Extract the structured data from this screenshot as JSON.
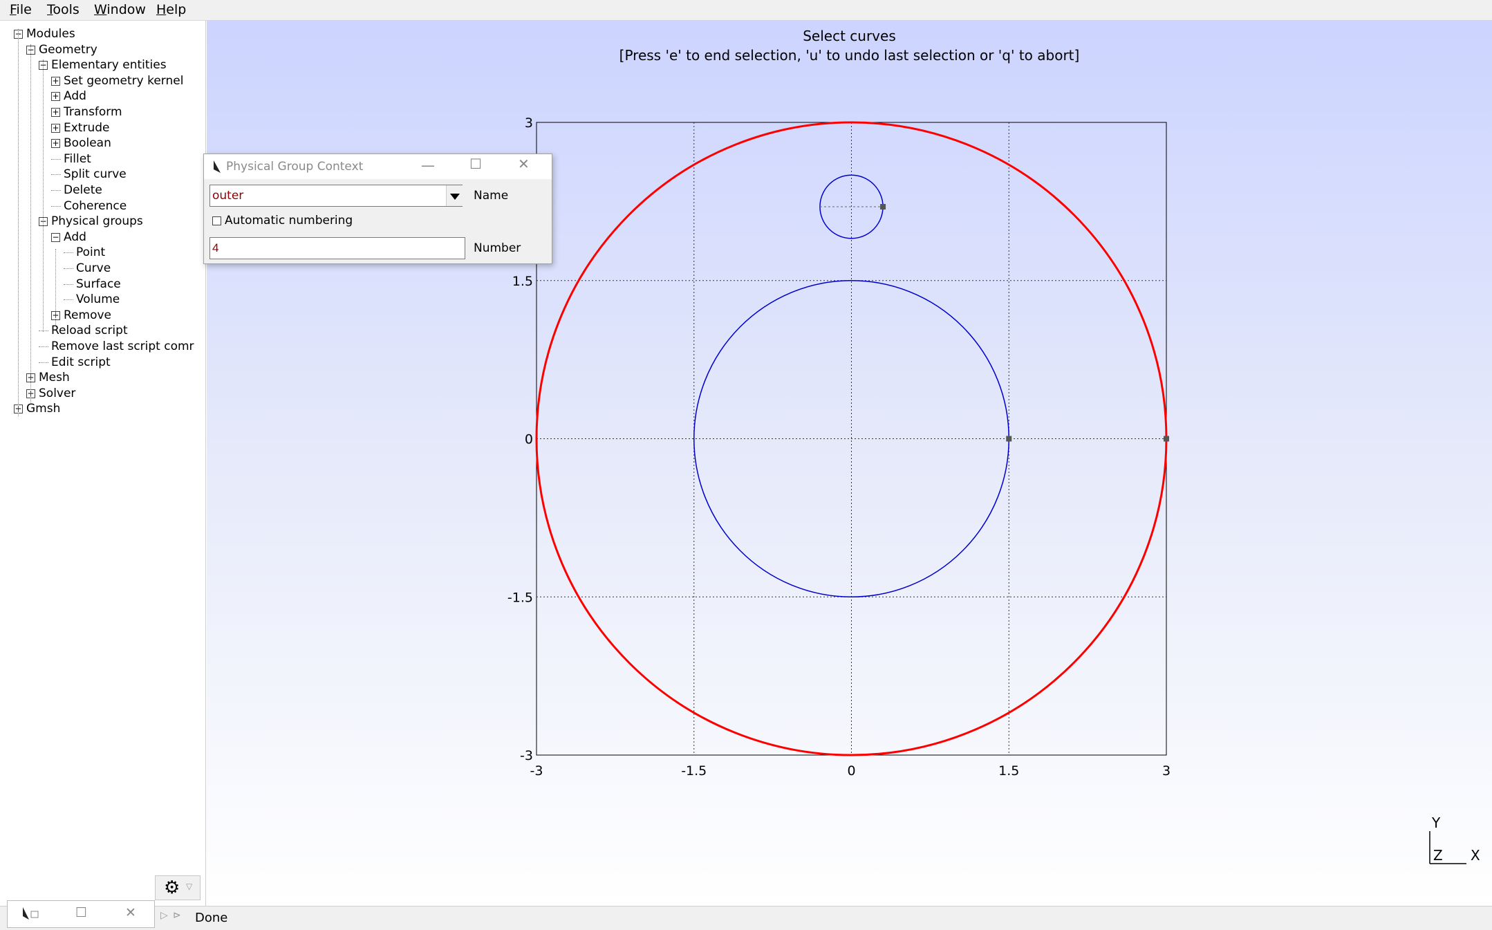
{
  "menu": [
    "File",
    "Tools",
    "Window",
    "Help"
  ],
  "tree": [
    {
      "label": "Modules",
      "box": "minus"
    },
    {
      "label": "Geometry",
      "box": "minus"
    },
    {
      "label": "Elementary entities",
      "box": "minus"
    },
    {
      "label": "Set geometry kernel",
      "box": "plus"
    },
    {
      "label": "Add",
      "box": "plus"
    },
    {
      "label": "Transform",
      "box": "plus"
    },
    {
      "label": "Extrude",
      "box": "plus"
    },
    {
      "label": "Boolean",
      "box": "plus"
    },
    {
      "label": "Fillet",
      "box": "none"
    },
    {
      "label": "Split curve",
      "box": "none"
    },
    {
      "label": "Delete",
      "box": "none"
    },
    {
      "label": "Coherence",
      "box": "none"
    },
    {
      "label": "Physical groups",
      "box": "minus"
    },
    {
      "label": "Add",
      "box": "minus"
    },
    {
      "label": "Point",
      "box": "none"
    },
    {
      "label": "Curve",
      "box": "none"
    },
    {
      "label": "Surface",
      "box": "none"
    },
    {
      "label": "Volume",
      "box": "none"
    },
    {
      "label": "Remove",
      "box": "plus"
    },
    {
      "label": "Reload script",
      "box": "none"
    },
    {
      "label": "Remove last script comr",
      "box": "none"
    },
    {
      "label": "Edit script",
      "box": "none"
    },
    {
      "label": "Mesh",
      "box": "plus"
    },
    {
      "label": "Solver",
      "box": "plus"
    },
    {
      "label": "Gmsh",
      "box": "plus"
    }
  ],
  "graphics": {
    "prompt_line1": "Select curves",
    "prompt_line2": "[Press 'e' to end selection, 'u' to undo last selection or 'q' to abort]",
    "axes_indicator": {
      "y": "Y",
      "z": "Z",
      "x": "X"
    }
  },
  "chart_data": {
    "type": "scatter",
    "xlim": [
      -3,
      3
    ],
    "ylim": [
      -3,
      3
    ],
    "x_ticks": [
      "-3",
      "-1.5",
      "0",
      "1.5",
      "3"
    ],
    "y_ticks": [
      "-3",
      "-1.5",
      "0",
      "1.5",
      "3"
    ],
    "grid": true,
    "curves": [
      {
        "kind": "circle",
        "cx": 0,
        "cy": 0,
        "r": 3,
        "color": "#ff0000",
        "selected": true
      },
      {
        "kind": "circle",
        "cx": 0,
        "cy": 0,
        "r": 1.5,
        "color": "#0000cc",
        "selected": false
      },
      {
        "kind": "circle",
        "cx": 0,
        "cy": 2.2,
        "r": 0.3,
        "color": "#0000cc",
        "selected": false
      }
    ],
    "points": [
      {
        "x": 3,
        "y": 0
      },
      {
        "x": 1.5,
        "y": 0
      },
      {
        "x": 0.3,
        "y": 2.2
      }
    ]
  },
  "dialog": {
    "title": "Physical Group Context",
    "name_value": "outer",
    "name_label": "Name",
    "auto_numbering_label": "Automatic numbering",
    "auto_numbering_checked": false,
    "number_value": "4",
    "number_label": "Number"
  },
  "status": {
    "text": "Done"
  },
  "colors": {
    "accent_selected": "#ff0000",
    "curve": "#0000cc",
    "background_top": "#ccd4ff"
  }
}
